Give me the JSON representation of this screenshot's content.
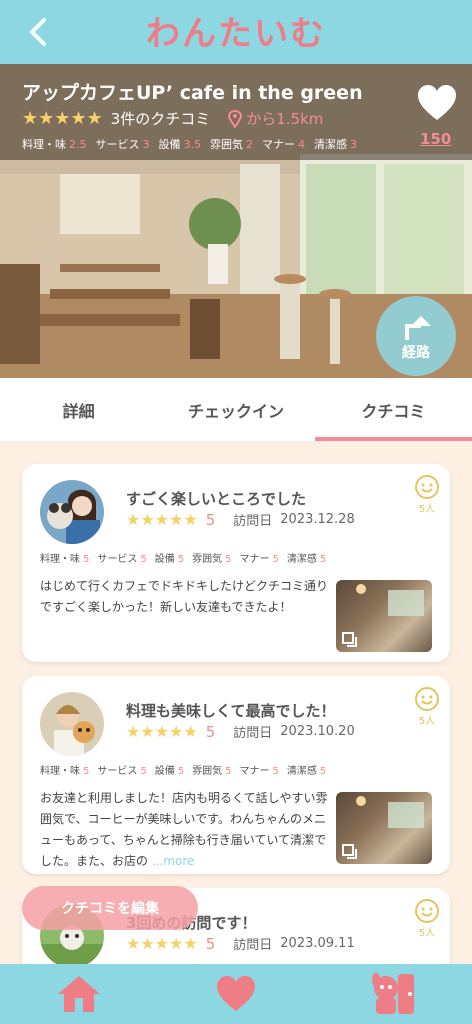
{
  "header": {
    "app_title": "わんたいむ",
    "back_icon": "chevron-left-icon"
  },
  "shop": {
    "name": "アップカフェUP’ cafe in the green",
    "stars": "★★★★★",
    "review_count_label": "3件のクチコミ",
    "distance_label": "から1.5km",
    "likes": "150",
    "scores": [
      {
        "label": "料理・味",
        "value": "2.5"
      },
      {
        "label": "サービス",
        "value": "3"
      },
      {
        "label": "設備",
        "value": "3.5"
      },
      {
        "label": "雰囲気",
        "value": "2"
      },
      {
        "label": "マナー",
        "value": "4"
      },
      {
        "label": "清潔感",
        "value": "3"
      }
    ],
    "route_label": "経路"
  },
  "tabs": [
    {
      "label": "詳細",
      "active": false
    },
    {
      "label": "チェックイン",
      "active": false
    },
    {
      "label": "クチコミ",
      "active": true
    }
  ],
  "reviews": [
    {
      "title": "すごく楽しいところでした",
      "stars": "★★★★★",
      "rating": "5",
      "visit_label": "訪問日",
      "visit_date": "2023.12.28",
      "likes": "5人",
      "scores": [
        {
          "label": "料理・味",
          "value": "5"
        },
        {
          "label": "サービス",
          "value": "5"
        },
        {
          "label": "設備",
          "value": "5"
        },
        {
          "label": "雰囲気",
          "value": "5"
        },
        {
          "label": "マナー",
          "value": "5"
        },
        {
          "label": "清潔感",
          "value": "5"
        }
      ],
      "body": "はじめて行くカフェでドキドキしたけどクチコミ通りですごく楽しかった！新しい友達もできたよ！",
      "more": ""
    },
    {
      "title": "料理も美味しくて最高でした！",
      "stars": "★★★★★",
      "rating": "5",
      "visit_label": "訪問日",
      "visit_date": "2023.10.20",
      "likes": "5人",
      "scores": [
        {
          "label": "料理・味",
          "value": "5"
        },
        {
          "label": "サービス",
          "value": "5"
        },
        {
          "label": "設備",
          "value": "5"
        },
        {
          "label": "雰囲気",
          "value": "5"
        },
        {
          "label": "マナー",
          "value": "5"
        },
        {
          "label": "清潔感",
          "value": "5"
        }
      ],
      "body": "お友達と利用しました！店内も明るくて話しやすい雰囲気で、コーヒーが美味しいです。わんちゃんのメニューもあって、ちゃんと掃除も行き届いていて清潔でした。また、お店の",
      "more": "...more"
    },
    {
      "title": "3回めの訪問です！",
      "stars": "★★★★★",
      "rating": "5",
      "visit_label": "訪問日",
      "visit_date": "2023.09.11",
      "likes": "5人"
    }
  ],
  "edit_button_label": "クチコミを編集",
  "bottom_nav": [
    "home-icon",
    "heart-icon",
    "mypage-dog-icon"
  ],
  "colors": {
    "accent_blue": "#8dd7e3",
    "accent_pink": "#f28d94",
    "star_yellow": "#f3d267",
    "background": "#fdf0e2"
  }
}
